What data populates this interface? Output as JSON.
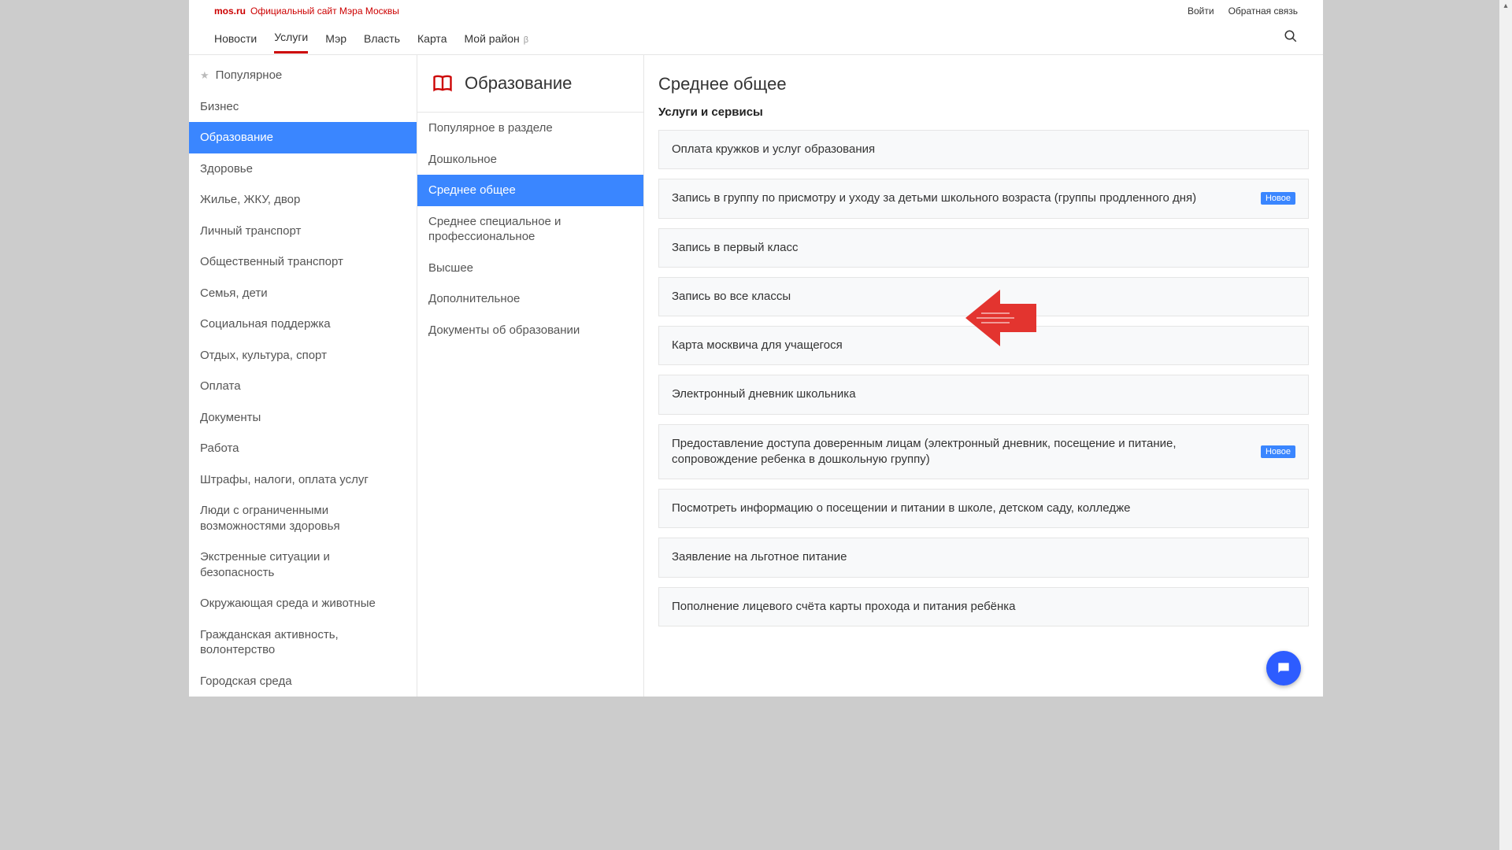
{
  "top": {
    "brand": "mos.ru",
    "brand_sub": "Официальный сайт Мэра Москвы",
    "login": "Войти",
    "feedback": "Обратная связь"
  },
  "nav": {
    "items": [
      "Новости",
      "Услуги",
      "Мэр",
      "Власть",
      "Карта",
      "Мой район"
    ],
    "active_index": 1,
    "beta_suffix": "β"
  },
  "sidebar": {
    "items": [
      {
        "label": "Популярное",
        "star": true
      },
      {
        "label": "Бизнес"
      },
      {
        "label": "Образование",
        "active": true
      },
      {
        "label": "Здоровье"
      },
      {
        "label": "Жилье, ЖКУ, двор"
      },
      {
        "label": "Личный транспорт"
      },
      {
        "label": "Общественный транспорт"
      },
      {
        "label": "Семья, дети"
      },
      {
        "label": "Социальная поддержка"
      },
      {
        "label": "Отдых, культура, спорт"
      },
      {
        "label": "Оплата"
      },
      {
        "label": "Документы"
      },
      {
        "label": "Работа"
      },
      {
        "label": "Штрафы, налоги, оплата услуг"
      },
      {
        "label": "Люди с ограниченными возможностями здоровья"
      },
      {
        "label": "Экстренные ситуации и безопасность"
      },
      {
        "label": "Окружающая среда и животные"
      },
      {
        "label": "Гражданская активность, волонтерство"
      },
      {
        "label": "Городская среда"
      }
    ]
  },
  "section": {
    "title": "Образование",
    "subcats": [
      {
        "label": "Популярное в разделе"
      },
      {
        "label": "Дошкольное"
      },
      {
        "label": "Среднее общее",
        "active": true
      },
      {
        "label": "Среднее специальное и профессиональное"
      },
      {
        "label": "Высшее"
      },
      {
        "label": "Дополнительное"
      },
      {
        "label": "Документы об образовании"
      }
    ]
  },
  "content": {
    "heading": "Среднее общее",
    "subhead": "Услуги и сервисы",
    "badge_new": "Новое",
    "services": [
      {
        "text": "Оплата кружков и услуг образования"
      },
      {
        "text": "Запись в группу по присмотру и уходу за детьми школьного возраста (группы продленного дня)",
        "new": true
      },
      {
        "text": "Запись в первый класс"
      },
      {
        "text": "Запись во все классы"
      },
      {
        "text": "Карта москвича для учащегося"
      },
      {
        "text": "Электронный дневник школьника"
      },
      {
        "text": "Предоставление доступа доверенным лицам (электронный дневник, посещение и питание, сопровождение ребенка в дошкольную группу)",
        "new": true
      },
      {
        "text": "Посмотреть информацию о посещении и питании в школе, детском саду, колледже"
      },
      {
        "text": "Заявление на льготное питание"
      },
      {
        "text": "Пополнение лицевого счёта карты прохода и питания ребёнка"
      }
    ]
  },
  "colors": {
    "accent_red": "#c00",
    "accent_blue": "#3a86ff"
  }
}
